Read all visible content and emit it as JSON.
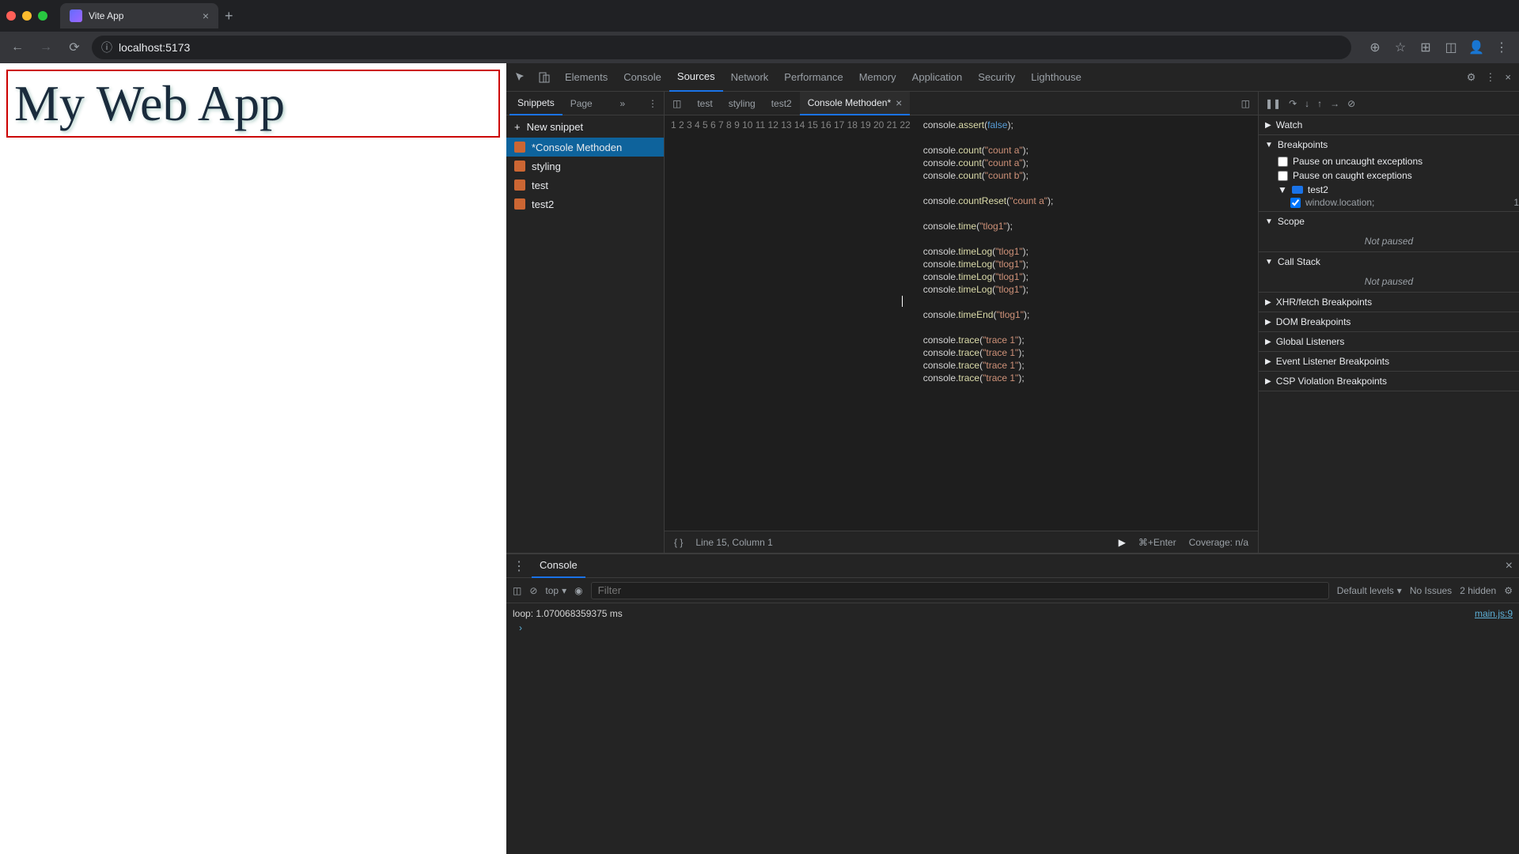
{
  "browser": {
    "tab_title": "Vite App",
    "url": "localhost:5173"
  },
  "page": {
    "heading": "My Web App"
  },
  "devtools": {
    "tabs": [
      "Elements",
      "Console",
      "Sources",
      "Network",
      "Performance",
      "Memory",
      "Application",
      "Security",
      "Lighthouse"
    ],
    "active_tab": "Sources"
  },
  "sources_sidebar": {
    "tabs": [
      "Snippets",
      "Page"
    ],
    "new_snippet_label": "New snippet",
    "snippets": [
      {
        "name": "*Console Methoden",
        "selected": true
      },
      {
        "name": "styling",
        "selected": false
      },
      {
        "name": "test",
        "selected": false
      },
      {
        "name": "test2",
        "selected": false
      }
    ]
  },
  "editor": {
    "tabs": [
      {
        "name": "test",
        "active": false
      },
      {
        "name": "styling",
        "active": false
      },
      {
        "name": "test2",
        "active": false
      },
      {
        "name": "Console Methoden*",
        "active": true
      }
    ],
    "code_lines": [
      {
        "n": 1,
        "tokens": [
          [
            "kw",
            "console."
          ],
          [
            "method",
            "assert"
          ],
          [
            "kw",
            "("
          ],
          [
            "bool",
            "false"
          ],
          [
            "kw",
            ");"
          ]
        ]
      },
      {
        "n": 2,
        "tokens": []
      },
      {
        "n": 3,
        "tokens": [
          [
            "kw",
            "console."
          ],
          [
            "method",
            "count"
          ],
          [
            "kw",
            "("
          ],
          [
            "str",
            "\"count a\""
          ],
          [
            "kw",
            ");"
          ]
        ]
      },
      {
        "n": 4,
        "tokens": [
          [
            "kw",
            "console."
          ],
          [
            "method",
            "count"
          ],
          [
            "kw",
            "("
          ],
          [
            "str",
            "\"count a\""
          ],
          [
            "kw",
            ");"
          ]
        ]
      },
      {
        "n": 5,
        "tokens": [
          [
            "kw",
            "console."
          ],
          [
            "method",
            "count"
          ],
          [
            "kw",
            "("
          ],
          [
            "str",
            "\"count b\""
          ],
          [
            "kw",
            ");"
          ]
        ]
      },
      {
        "n": 6,
        "tokens": []
      },
      {
        "n": 7,
        "tokens": [
          [
            "kw",
            "console."
          ],
          [
            "method",
            "countReset"
          ],
          [
            "kw",
            "("
          ],
          [
            "str",
            "\"count a\""
          ],
          [
            "kw",
            ");"
          ]
        ]
      },
      {
        "n": 8,
        "tokens": []
      },
      {
        "n": 9,
        "tokens": [
          [
            "kw",
            "console."
          ],
          [
            "method",
            "time"
          ],
          [
            "kw",
            "("
          ],
          [
            "str",
            "\"tlog1\""
          ],
          [
            "kw",
            ");"
          ]
        ]
      },
      {
        "n": 10,
        "tokens": []
      },
      {
        "n": 11,
        "tokens": [
          [
            "kw",
            "console."
          ],
          [
            "method",
            "timeLog"
          ],
          [
            "kw",
            "("
          ],
          [
            "str",
            "\"tlog1\""
          ],
          [
            "kw",
            ");"
          ]
        ]
      },
      {
        "n": 12,
        "tokens": [
          [
            "kw",
            "console."
          ],
          [
            "method",
            "timeLog"
          ],
          [
            "kw",
            "("
          ],
          [
            "str",
            "\"tlog1\""
          ],
          [
            "kw",
            ");"
          ]
        ]
      },
      {
        "n": 13,
        "tokens": [
          [
            "kw",
            "console."
          ],
          [
            "method",
            "timeLog"
          ],
          [
            "kw",
            "("
          ],
          [
            "str",
            "\"tlog1\""
          ],
          [
            "kw",
            ");"
          ]
        ]
      },
      {
        "n": 14,
        "tokens": [
          [
            "kw",
            "console."
          ],
          [
            "method",
            "timeLog"
          ],
          [
            "kw",
            "("
          ],
          [
            "str",
            "\"tlog1\""
          ],
          [
            "kw",
            ");"
          ]
        ]
      },
      {
        "n": 15,
        "tokens": []
      },
      {
        "n": 16,
        "tokens": [
          [
            "kw",
            "console."
          ],
          [
            "method",
            "timeEnd"
          ],
          [
            "kw",
            "("
          ],
          [
            "str",
            "\"tlog1\""
          ],
          [
            "kw",
            ");"
          ]
        ]
      },
      {
        "n": 17,
        "tokens": []
      },
      {
        "n": 18,
        "tokens": [
          [
            "kw",
            "console."
          ],
          [
            "method",
            "trace"
          ],
          [
            "kw",
            "("
          ],
          [
            "str",
            "\"trace 1\""
          ],
          [
            "kw",
            ");"
          ]
        ]
      },
      {
        "n": 19,
        "tokens": [
          [
            "kw",
            "console."
          ],
          [
            "method",
            "trace"
          ],
          [
            "kw",
            "("
          ],
          [
            "str",
            "\"trace 1\""
          ],
          [
            "kw",
            ");"
          ]
        ]
      },
      {
        "n": 20,
        "tokens": [
          [
            "kw",
            "console."
          ],
          [
            "method",
            "trace"
          ],
          [
            "kw",
            "("
          ],
          [
            "str",
            "\"trace 1\""
          ],
          [
            "kw",
            ");"
          ]
        ]
      },
      {
        "n": 21,
        "tokens": [
          [
            "kw",
            "console."
          ],
          [
            "method",
            "trace"
          ],
          [
            "kw",
            "("
          ],
          [
            "str",
            "\"trace 1\""
          ],
          [
            "kw",
            ");"
          ]
        ]
      },
      {
        "n": 22,
        "tokens": []
      }
    ],
    "status": {
      "position": "Line 15, Column 1",
      "run_hint": "⌘+Enter",
      "coverage": "Coverage: n/a"
    }
  },
  "debugger": {
    "sections": {
      "watch": "Watch",
      "breakpoints": "Breakpoints",
      "pause_uncaught": "Pause on uncaught exceptions",
      "pause_caught": "Pause on caught exceptions",
      "bp_file": "test2",
      "bp_code": "window.location;",
      "bp_line": "1",
      "scope": "Scope",
      "not_paused": "Not paused",
      "call_stack": "Call Stack",
      "xhr": "XHR/fetch Breakpoints",
      "dom": "DOM Breakpoints",
      "global": "Global Listeners",
      "event": "Event Listener Breakpoints",
      "csp": "CSP Violation Breakpoints"
    }
  },
  "console": {
    "tab": "Console",
    "context": "top",
    "filter_placeholder": "Filter",
    "levels": "Default levels",
    "issues": "No Issues",
    "hidden": "2 hidden",
    "output": {
      "text": "loop: 1.070068359375 ms",
      "source": "main.js:9"
    }
  }
}
